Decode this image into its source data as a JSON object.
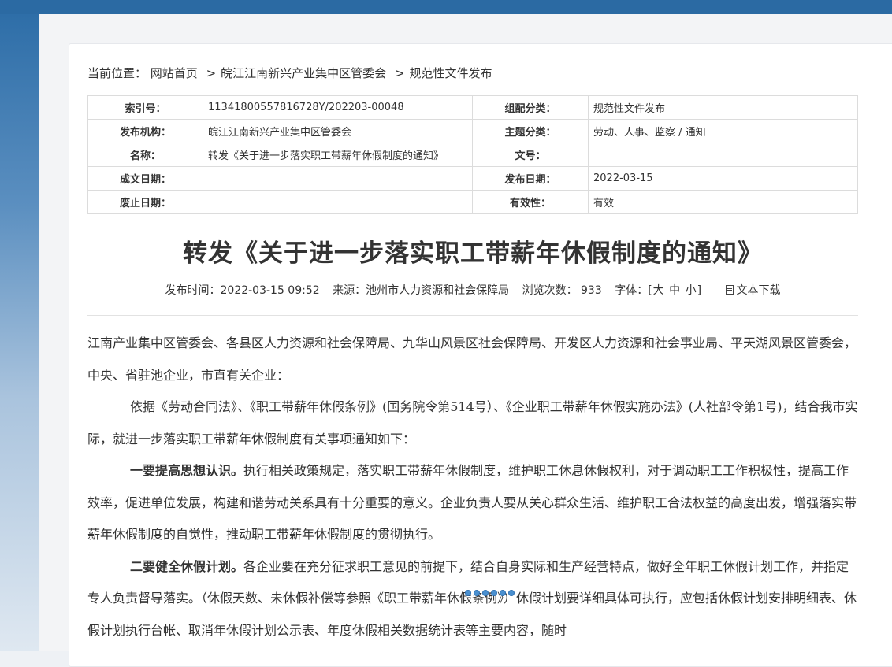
{
  "breadcrumb": {
    "label": "当前位置：",
    "items": [
      "网站首页",
      "皖江江南新兴产业集中区管委会",
      "规范性文件发布"
    ],
    "separator": ">"
  },
  "meta": {
    "rows": [
      [
        {
          "k": "索引号：",
          "v": "11341800557816728Y/202203-00048"
        },
        {
          "k": "组配分类：",
          "v": "规范性文件发布"
        }
      ],
      [
        {
          "k": "发布机构：",
          "v": "皖江江南新兴产业集中区管委会"
        },
        {
          "k": "主题分类：",
          "v": "劳动、人事、监察 / 通知"
        }
      ],
      [
        {
          "k": "名称：",
          "v": "转发《关于进一步落实职工带薪年休假制度的通知》"
        },
        {
          "k": "文号：",
          "v": ""
        }
      ],
      [
        {
          "k": "成文日期：",
          "v": ""
        },
        {
          "k": "发布日期：",
          "v": "2022-03-15"
        }
      ],
      [
        {
          "k": "废止日期：",
          "v": ""
        },
        {
          "k": "有效性：",
          "v": "有效"
        }
      ]
    ]
  },
  "article": {
    "title": "转发《关于进一步落实职工带薪年休假制度的通知》",
    "publish_time": "发布时间：2022-03-15 09:52",
    "source": "来源：池州市人力资源和社会保障局",
    "views": "浏览次数： 933",
    "font_label": "字体：[",
    "font_large": "大",
    "font_medium": "中",
    "font_small": "小",
    "font_close": "]",
    "download": "文本下载",
    "para1": "江南产业集中区管委会、各县区人力资源和社会保障局、九华山风景区社会保障局、开发区人力资源和社会事业局、平天湖风景区管委会，中央、省驻池企业，市直有关企业：",
    "para2": "依据《劳动合同法》、《职工带薪年休假条例》(国务院令第514号）、《企业职工带薪年休假实施办法》(人社部令第1号)，结合我市实际，就进一步落实职工带薪年休假制度有关事项通知如下：",
    "para3_lead": "一要提高思想认识。",
    "para3": "执行相关政策规定，落实职工带薪年休假制度，维护职工休息休假权利，对于调动职工工作积极性，提高工作效率，促进单位发展，构建和谐劳动关系具有十分重要的意义。企业负责人要从关心群众生活、维护职工合法权益的高度出发，增强落实带薪年休假制度的自觉性，推动职工带薪年休假制度的贯彻执行。",
    "para4_lead": "二要健全休假计划。",
    "para4": "各企业要在充分征求职工意见的前提下，结合自身实际和生产经营特点，做好全年职工休假计划工作，并指定专人负责督导落实。（休假天数、未休假补偿等参照《职工带薪年休假条例》）休假计划要详细具体可执行，应包括休假计划安排明细表、休假计划执行台帐、取消年休假计划公示表、年度休假相关数据统计表等主要内容，随时"
  },
  "colors": {
    "header_blue": "#2b6aa3",
    "dot_blue": "#4a90d0"
  }
}
